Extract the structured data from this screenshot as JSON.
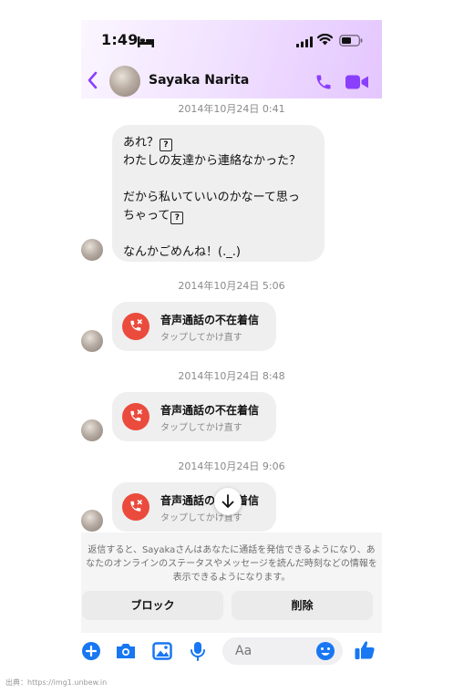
{
  "status_bar": {
    "time": "1:49",
    "icons": [
      "bed-icon",
      "signal-icon",
      "wifi-icon",
      "battery-icon"
    ]
  },
  "header": {
    "contact_name": "Sayaka Narita",
    "icons": [
      "back-icon",
      "phone-icon",
      "video-icon"
    ]
  },
  "messages": {
    "stamp1": "2014年10月24日 0:41",
    "text_line1": "あれ？",
    "text_line2": "わたしの友達から連絡なかった？",
    "text_line3": "だから私いていいのかなーて思っ",
    "text_line4": "ちゃって",
    "text_line5": "なんかごめんね！(._.)",
    "qmark": "?",
    "stamp2": "2014年10月24日 5:06",
    "stamp3": "2014年10月24日 8:48",
    "stamp4": "2014年10月24日 9:06",
    "missed_title": "音声通話の不在着信",
    "missed_sub": "タップしてかけ直す"
  },
  "notice": {
    "text": "返信すると、Sayakaさんはあなたに通話を発信できるようになり、あなたのオンラインのステータスやメッセージを読んだ時刻などの情報を表示できるようになります。",
    "block_label": "ブロック",
    "delete_label": "削除"
  },
  "composer": {
    "placeholder": "Aa",
    "icons": [
      "plus-icon",
      "camera-icon",
      "image-icon",
      "mic-icon",
      "emoji-icon",
      "like-icon"
    ]
  },
  "source_caption": "出典：https://img1.unbew.in",
  "colors": {
    "accent": "#8a3ffc",
    "missed": "#ea4b3c",
    "composer_blue": "#1877f2"
  }
}
